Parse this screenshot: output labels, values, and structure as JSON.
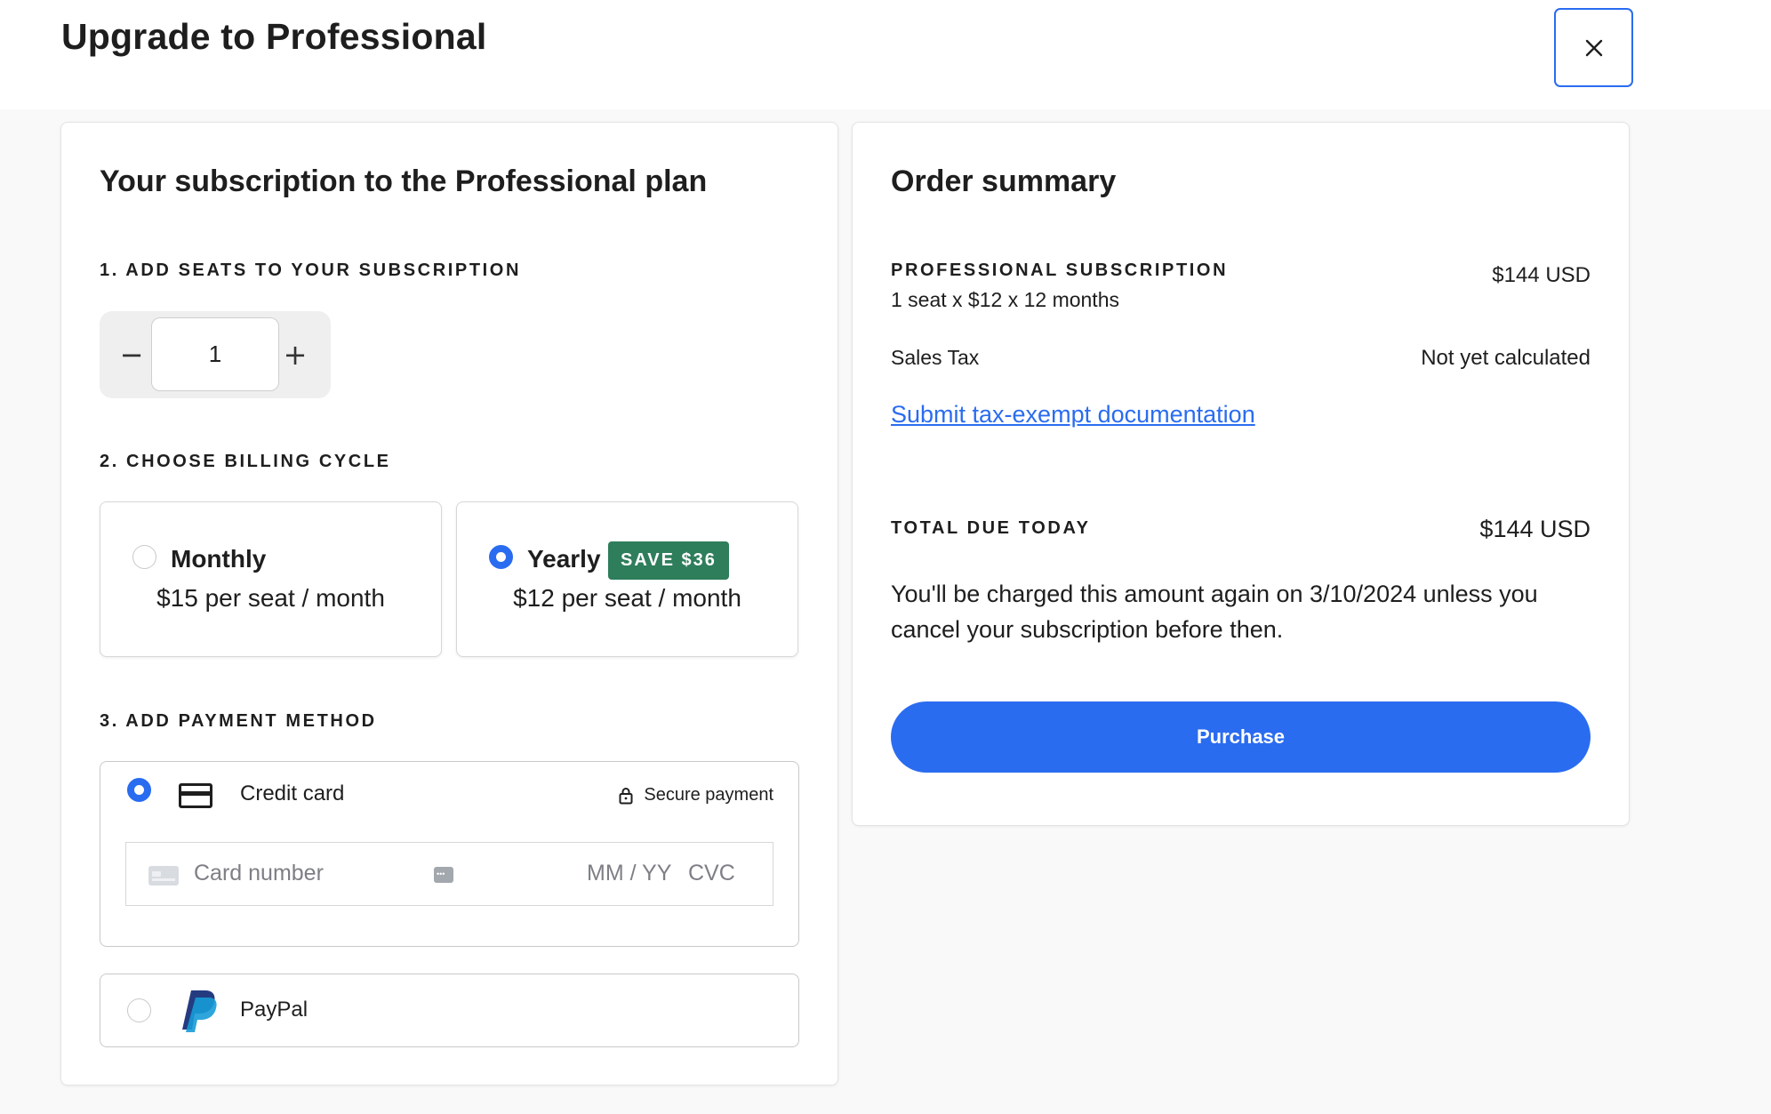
{
  "header": {
    "title": "Upgrade to Professional",
    "close_icon": "close-icon"
  },
  "subscription": {
    "title": "Your subscription to the Professional plan",
    "step1": "1. ADD SEATS TO YOUR SUBSCRIPTION",
    "seats": {
      "minus": "−",
      "value": "1",
      "plus": "+"
    },
    "step2": "2. CHOOSE BILLING CYCLE",
    "billing": {
      "monthly": {
        "name": "Monthly",
        "price": "$15 per seat / month",
        "selected": false
      },
      "yearly": {
        "name": "Yearly",
        "badge": "SAVE $36",
        "price": "$12 per seat / month",
        "selected": true
      }
    },
    "step3": "3. ADD PAYMENT METHOD",
    "payment": {
      "credit_card": {
        "label": "Credit card",
        "secure": "Secure payment",
        "number_placeholder": "Card number",
        "expiry_placeholder": "MM / YY",
        "cvc_placeholder": "CVC",
        "selected": true
      },
      "paypal": {
        "label": "PayPal",
        "selected": false
      }
    }
  },
  "summary": {
    "title": "Order summary",
    "item_label": "PROFESSIONAL SUBSCRIPTION",
    "item_detail": "1 seat x $12 x 12 months",
    "item_price": "$144 USD",
    "tax_label": "Sales Tax",
    "tax_value": "Not yet calculated",
    "tax_link": "Submit tax-exempt documentation",
    "total_label": "TOTAL DUE TODAY",
    "total_value": "$144 USD",
    "charge_note": "You'll be charged this amount again on 3/10/2024 unless you cancel your subscription before then.",
    "purchase_label": "Purchase"
  },
  "colors": {
    "accent": "#2a6cf0",
    "save_badge": "#2e7d5b",
    "background": "#f9f9f9"
  }
}
